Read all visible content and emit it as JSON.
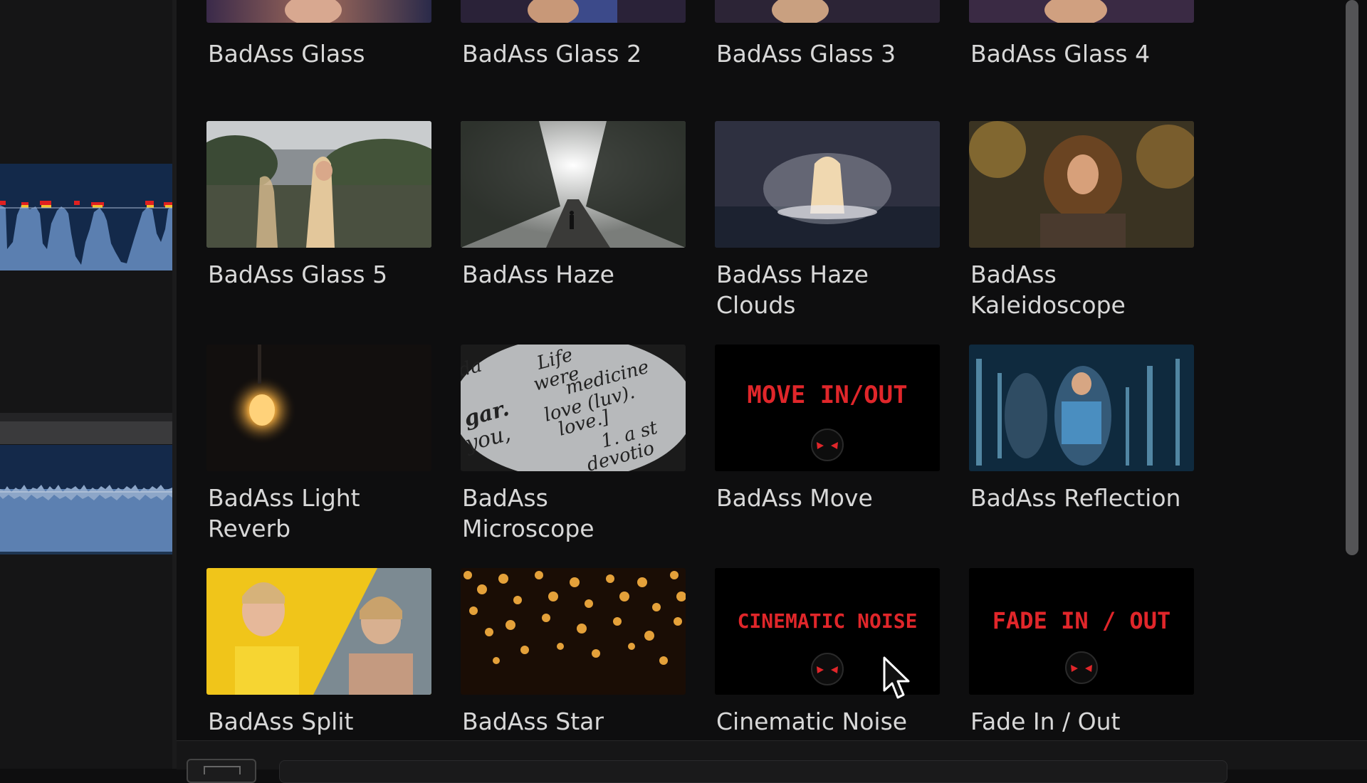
{
  "effects": [
    {
      "label": "BadAss Glass",
      "thumb": "glass"
    },
    {
      "label": "BadAss Glass 2",
      "thumb": "glass"
    },
    {
      "label": "BadAss Glass 3",
      "thumb": "glass"
    },
    {
      "label": "BadAss Glass 4",
      "thumb": "glass"
    },
    {
      "label": "BadAss Glass 5",
      "thumb": "forest-woman"
    },
    {
      "label": "BadAss Haze",
      "thumb": "foggy-road"
    },
    {
      "label": "BadAss Haze\nClouds",
      "thumb": "water-splash"
    },
    {
      "label": "BadAss\nKaleidoscope",
      "thumb": "curly-woman"
    },
    {
      "label": "BadAss Light\nReverb",
      "thumb": "light-bulb"
    },
    {
      "label": "BadAss\nMicroscope",
      "thumb": "dictionary"
    },
    {
      "label": "BadAss Move",
      "thumb": "title-card",
      "card_text": "MOVE IN/OUT"
    },
    {
      "label": "BadAss Reflection",
      "thumb": "mirror-dancer"
    },
    {
      "label": "BadAss Split",
      "thumb": "split-women"
    },
    {
      "label": "BadAss Star",
      "thumb": "bokeh-lights"
    },
    {
      "label": "Cinematic Noise",
      "thumb": "title-card",
      "card_text": "CINEMATIC NOISE"
    },
    {
      "label": "Fade In / Out",
      "thumb": "title-card",
      "card_text": "FADE IN / OUT"
    }
  ],
  "microscope_words": [
    "Life",
    "were",
    "medicine",
    "gar.",
    "love (luv).",
    "you,",
    "love.]",
    "1. a st",
    "devotio",
    "da"
  ],
  "colors": {
    "background": "#0e0e0f",
    "card_text_red": "#e0262a",
    "waveform_blue": "#5b7fb0",
    "peak_red": "#e02020",
    "peak_yellow": "#f2c12e"
  },
  "icons": [
    "logo-mask-icon",
    "pointer-cursor-icon",
    "scrollbar-thumb"
  ]
}
